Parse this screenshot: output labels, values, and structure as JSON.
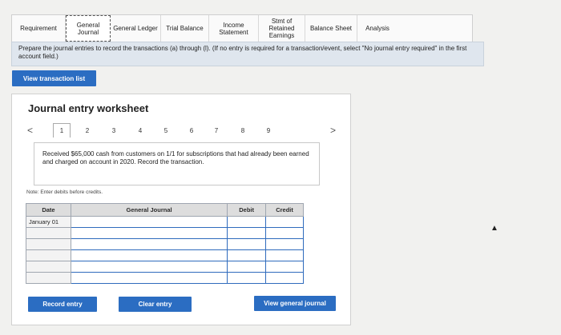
{
  "tabs": [
    {
      "label": "Requirement"
    },
    {
      "label": "General Journal"
    },
    {
      "label": "General Ledger"
    },
    {
      "label": "Trial Balance"
    },
    {
      "label": "Income Statement"
    },
    {
      "label": "Stmt of Retained Earnings"
    },
    {
      "label": "Balance Sheet"
    },
    {
      "label": "Analysis"
    }
  ],
  "instructions": "Prepare the journal entries to record the transactions (a) through (l). (If no entry is required for a transaction/event, select \"No journal entry required\" in the first account field.)",
  "view_transaction_list": "View transaction list",
  "worksheet": {
    "title": "Journal entry worksheet",
    "pages": [
      "1",
      "2",
      "3",
      "4",
      "5",
      "6",
      "7",
      "8",
      "9"
    ],
    "prev": "<",
    "next": ">",
    "description": "Received $65,000 cash from customers on 1/1 for subscriptions that had already been earned and charged on account in 2020. Record the transaction.",
    "note": "Note: Enter debits before credits.",
    "columns": {
      "date": "Date",
      "journal": "General Journal",
      "debit": "Debit",
      "credit": "Credit"
    },
    "rows": [
      {
        "date": "January 01"
      },
      {
        "date": ""
      },
      {
        "date": ""
      },
      {
        "date": ""
      },
      {
        "date": ""
      },
      {
        "date": ""
      }
    ]
  },
  "buttons": {
    "record": "Record entry",
    "clear": "Clear entry",
    "view_general": "View general journal"
  },
  "colors": {
    "accent": "#2b6dc2",
    "input_border": "#2f6bbd"
  }
}
